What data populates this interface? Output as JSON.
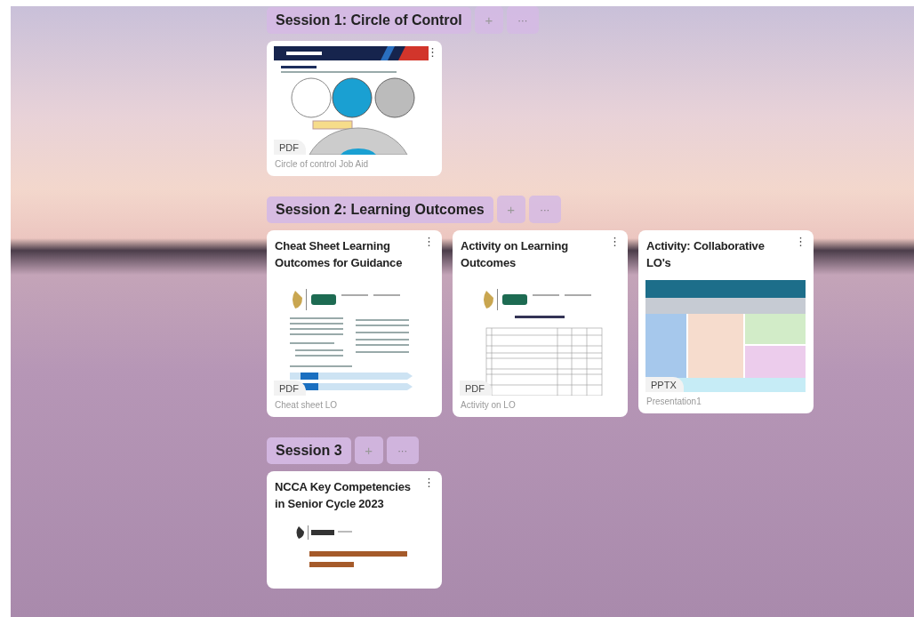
{
  "sections": [
    {
      "title": "Session 1: Circle of Control",
      "add_label": "+",
      "more_label": "···",
      "cards": [
        {
          "kind": "circles",
          "file_type": "PDF",
          "caption": "Circle of control Job Aid",
          "menu": "⋮"
        }
      ]
    },
    {
      "title": "Session 2: Learning Outcomes",
      "add_label": "+",
      "more_label": "···",
      "cards": [
        {
          "title": "Cheat Sheet Learning Outcomes for Guidance",
          "kind": "text-document",
          "file_type": "PDF",
          "caption": "Cheat sheet LO",
          "menu": "⋮"
        },
        {
          "title": "Activity on Learning Outcomes",
          "kind": "table-document",
          "file_type": "PDF",
          "caption": "Activity on LO",
          "menu": "⋮"
        },
        {
          "title": "Activity: Collaborative LO's",
          "kind": "slide-grid",
          "file_type": "PPTX",
          "caption": "Presentation1",
          "menu": "⋮"
        }
      ]
    },
    {
      "title": "Session 3",
      "add_label": "+",
      "more_label": "···",
      "cards": [
        {
          "title": "NCCA Key Competencies in Senior Cycle 2023",
          "kind": "cover-page",
          "menu": "⋮"
        }
      ]
    }
  ]
}
